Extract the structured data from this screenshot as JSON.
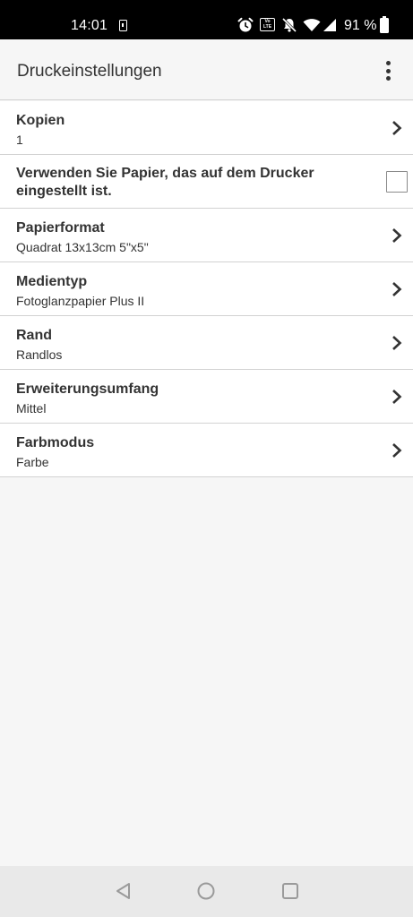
{
  "status_bar": {
    "time": "14:01",
    "battery": "91 %",
    "volte_label_top": "Vo",
    "volte_label_bottom": "LTE"
  },
  "app_bar": {
    "title": "Druckeinstellungen",
    "menu_icon": "more-vert-icon"
  },
  "settings": [
    {
      "label": "Kopien",
      "value": "1"
    },
    {
      "label": "Verwenden Sie Papier, das auf dem Drucker eingestellt ist.",
      "checked": false
    },
    {
      "label": "Papierformat",
      "value": "Quadrat 13x13cm 5\"x5\""
    },
    {
      "label": "Medientyp",
      "value": "Fotoglanzpapier Plus II"
    },
    {
      "label": "Rand",
      "value": "Randlos"
    },
    {
      "label": "Erweiterungsumfang",
      "value": "Mittel"
    },
    {
      "label": "Farbmodus",
      "value": "Farbe"
    }
  ],
  "nav_bar": {
    "icons": [
      "back-icon",
      "home-icon",
      "recents-icon"
    ]
  },
  "colors": {
    "background": "#f6f6f6",
    "row_background": "#ffffff",
    "divider": "#d2d2d2",
    "text": "#333333",
    "status_bar": "#000000",
    "nav_bar": "#e9e9e9"
  }
}
